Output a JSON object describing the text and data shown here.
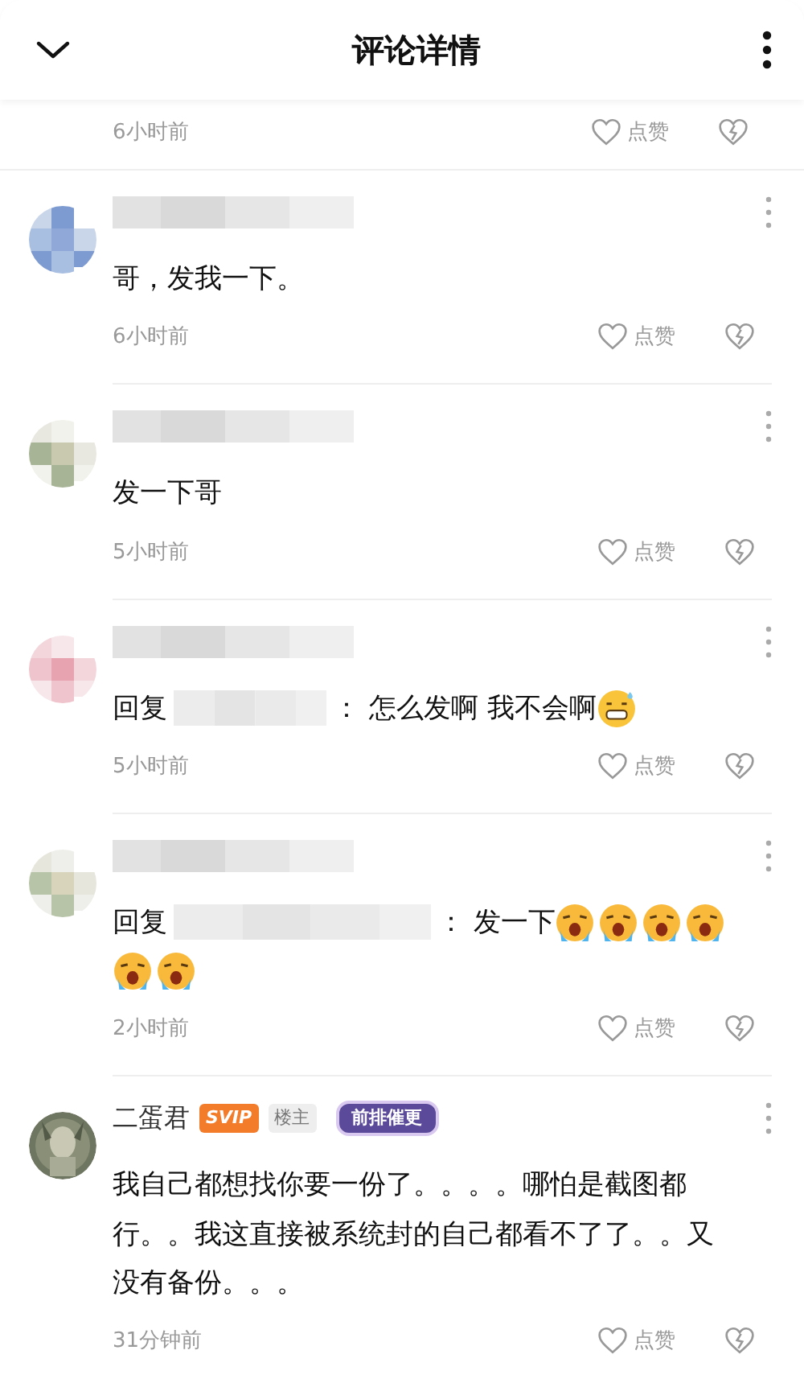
{
  "header": {
    "title": "评论详情"
  },
  "comments": [
    {
      "kind": "partial",
      "time": "6小时前",
      "like_label": "点赞"
    },
    {
      "kind": "comment",
      "name_hidden": true,
      "text": "哥，发我一下。",
      "time": "6小时前",
      "like_label": "点赞"
    },
    {
      "kind": "comment",
      "name_hidden": true,
      "text": "发一下哥",
      "time": "5小时前",
      "like_label": "点赞"
    },
    {
      "kind": "reply",
      "name_hidden": true,
      "reply_prefix": "回复",
      "reply_sep": "：",
      "text": "怎么发啊 我不会啊",
      "emojis": [
        {
          "kind": "grimace"
        }
      ],
      "time": "5小时前",
      "like_label": "点赞"
    },
    {
      "kind": "reply",
      "name_hidden": true,
      "reply_prefix": "回复",
      "reply_sep": "：",
      "text": "发一下",
      "emojis": [
        {
          "kind": "crying"
        },
        {
          "kind": "crying"
        },
        {
          "kind": "crying"
        },
        {
          "kind": "crying"
        },
        {
          "kind": "crying"
        },
        {
          "kind": "crying"
        }
      ],
      "time": "2小时前",
      "like_label": "点赞"
    },
    {
      "kind": "comment",
      "name": "二蛋君",
      "badges": [
        {
          "kind": "vip",
          "label": "SVIP"
        },
        {
          "kind": "author",
          "label": "楼主"
        },
        {
          "kind": "medal",
          "label": "前排催更"
        }
      ],
      "text": "我自己都想找你要一份了。。。。哪怕是截图都行。。我这直接被系统封的自己都看不了了。。又没有备份。。。",
      "time": "31分钟前",
      "like_label": "点赞"
    }
  ]
}
